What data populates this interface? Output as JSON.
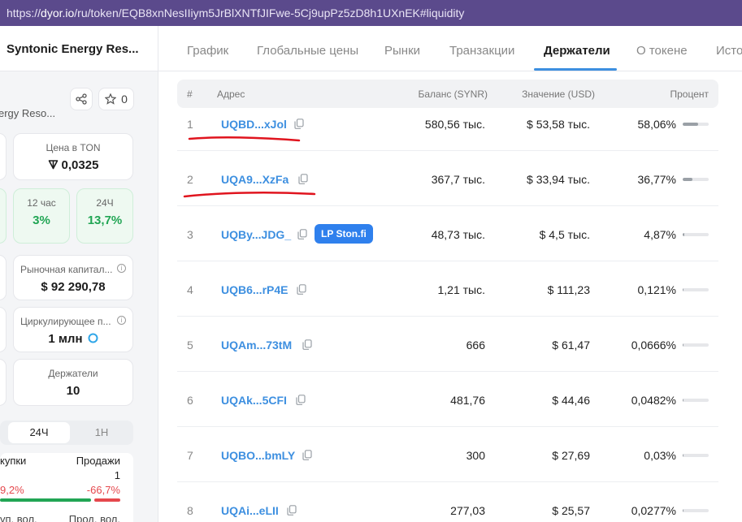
{
  "browser": {
    "url_prefix": "https://",
    "url_host": "dyor.io",
    "url_path": "/ru/token/EQB8xnNesIIiym5JrBlXNTfJIFwe-5Cj9upPz5zD8h1UXnEK#liquidity"
  },
  "token": {
    "name": "Syntonic Energy Res...",
    "subname": "ergy Reso...",
    "favorites_count": "0"
  },
  "stats": {
    "price_label": "Цена в TON",
    "price_value": "0,0325",
    "change_12h_label": "12 час",
    "change_12h_value": "3%",
    "change_24h_label": "24Ч",
    "change_24h_value": "13,7%",
    "market_cap_label": "Рыночная капитал...",
    "market_cap_value": "$ 92 290,78",
    "circulating_label": "Циркулирующее п...",
    "circulating_value": "1 млн",
    "holders_label": "Держатели",
    "holders_value": "10"
  },
  "period_toggle": {
    "active": "24Ч",
    "inactive": "1Н"
  },
  "trades": {
    "buys_label": "купки",
    "sells_label": "Продажи",
    "sells_count": "1",
    "buys_pct": "9,2%",
    "sells_pct": "-66,7%",
    "buy_vol_label": "уп. вол.",
    "sell_vol_label": "Прод. вол."
  },
  "tabs": [
    {
      "label": "График"
    },
    {
      "label": "Глобальные цены"
    },
    {
      "label": "Рынки"
    },
    {
      "label": "Транзакции"
    },
    {
      "label": "Держатели"
    },
    {
      "label": "О токене"
    },
    {
      "label": "Исто"
    }
  ],
  "active_tab": "Держатели",
  "table": {
    "headers": {
      "num": "#",
      "address": "Адрес",
      "balance": "Баланс (SYNR)",
      "value": "Значение (USD)",
      "percent": "Процент"
    },
    "rows": [
      {
        "num": "1",
        "address": "UQBD...xJol",
        "balance": "580,56 тыс.",
        "value": "$ 53,58 тыс.",
        "percent": "58,06%",
        "share": 0.5806
      },
      {
        "num": "2",
        "address": "UQA9...XzFa",
        "balance": "367,7 тыс.",
        "value": "$ 33,94 тыс.",
        "percent": "36,77%",
        "share": 0.3677
      },
      {
        "num": "3",
        "address": "UQBy...JDG_",
        "badge": "LP Ston.fi",
        "balance": "48,73 тыс.",
        "value": "$ 4,5 тыс.",
        "percent": "4,87%",
        "share": 0.0487
      },
      {
        "num": "4",
        "address": "UQB6...rP4E",
        "balance": "1,21 тыс.",
        "value": "$ 111,23",
        "percent": "0,121%",
        "share": 0.00121
      },
      {
        "num": "5",
        "address": "UQAm...73tM",
        "balance": "666",
        "value": "$ 61,47",
        "percent": "0,0666%",
        "share": 0.000666
      },
      {
        "num": "6",
        "address": "UQAk...5CFI",
        "balance": "481,76",
        "value": "$ 44,46",
        "percent": "0,0482%",
        "share": 0.000482
      },
      {
        "num": "7",
        "address": "UQBO...bmLY",
        "balance": "300",
        "value": "$ 27,69",
        "percent": "0,03%",
        "share": 0.0003
      },
      {
        "num": "8",
        "address": "UQAi...eLII",
        "balance": "277,03",
        "value": "$ 25,57",
        "percent": "0,0277%",
        "share": 0.000277
      }
    ]
  },
  "colors": {
    "accent": "#3d8fe0",
    "positive": "#21a554",
    "negative": "#e5484d",
    "annotation": "#e0141e"
  }
}
